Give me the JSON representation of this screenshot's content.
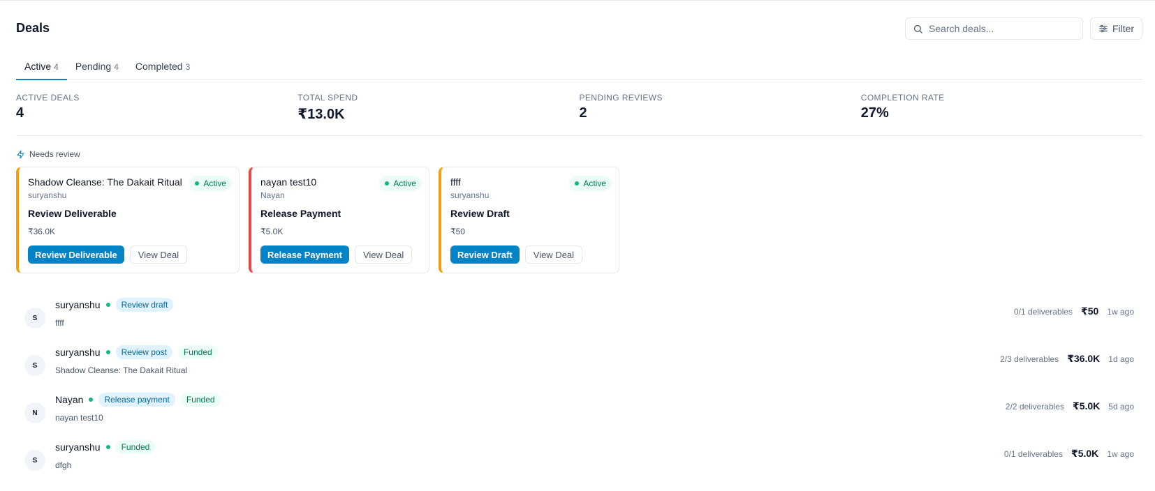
{
  "page": {
    "title": "Deals"
  },
  "search": {
    "placeholder": "Search deals..."
  },
  "filter": {
    "label": "Filter"
  },
  "tabs": [
    {
      "label": "Active",
      "count": "4"
    },
    {
      "label": "Pending",
      "count": "4"
    },
    {
      "label": "Completed",
      "count": "3"
    }
  ],
  "stats": [
    {
      "label": "ACTIVE DEALS",
      "value": "4"
    },
    {
      "label": "TOTAL SPEND",
      "value": "₹13.0K"
    },
    {
      "label": "PENDING REVIEWS",
      "value": "2"
    },
    {
      "label": "COMPLETION RATE",
      "value": "27%"
    }
  ],
  "needs_review": {
    "label": "Needs review"
  },
  "cards": [
    {
      "title": "Shadow Cleanse: The Dakait Ritual",
      "creator": "suryanshu",
      "status": "Active",
      "action": "Review Deliverable",
      "amount": "₹36.0K",
      "primary_btn": "Review Deliverable",
      "secondary_btn": "View Deal",
      "accent": "#f59e0b"
    },
    {
      "title": "nayan test10",
      "creator": "Nayan",
      "status": "Active",
      "action": "Release Payment",
      "amount": "₹5.0K",
      "primary_btn": "Release Payment",
      "secondary_btn": "View Deal",
      "accent": "#ef4444"
    },
    {
      "title": "ffff",
      "creator": "suryanshu",
      "status": "Active",
      "action": "Review Draft",
      "amount": "₹50",
      "primary_btn": "Review Draft",
      "secondary_btn": "View Deal",
      "accent": "#f59e0b"
    }
  ],
  "deals": [
    {
      "initial": "S",
      "name": "suryanshu",
      "tags": [
        "Review draft"
      ],
      "funded": "",
      "subtitle": "ffff",
      "deliverables": "0/1 deliverables",
      "amount": "₹50",
      "time": "1w ago"
    },
    {
      "initial": "S",
      "name": "suryanshu",
      "tags": [
        "Review post"
      ],
      "funded": "Funded",
      "subtitle": "Shadow Cleanse: The Dakait Ritual",
      "deliverables": "2/3 deliverables",
      "amount": "₹36.0K",
      "time": "1d ago"
    },
    {
      "initial": "N",
      "name": "Nayan",
      "tags": [
        "Release payment"
      ],
      "funded": "Funded",
      "subtitle": "nayan test10",
      "deliverables": "2/2 deliverables",
      "amount": "₹5.0K",
      "time": "5d ago"
    },
    {
      "initial": "S",
      "name": "suryanshu",
      "tags": [],
      "funded": "Funded",
      "subtitle": "dfgh",
      "deliverables": "0/1 deliverables",
      "amount": "₹5.0K",
      "time": "1w ago"
    }
  ]
}
